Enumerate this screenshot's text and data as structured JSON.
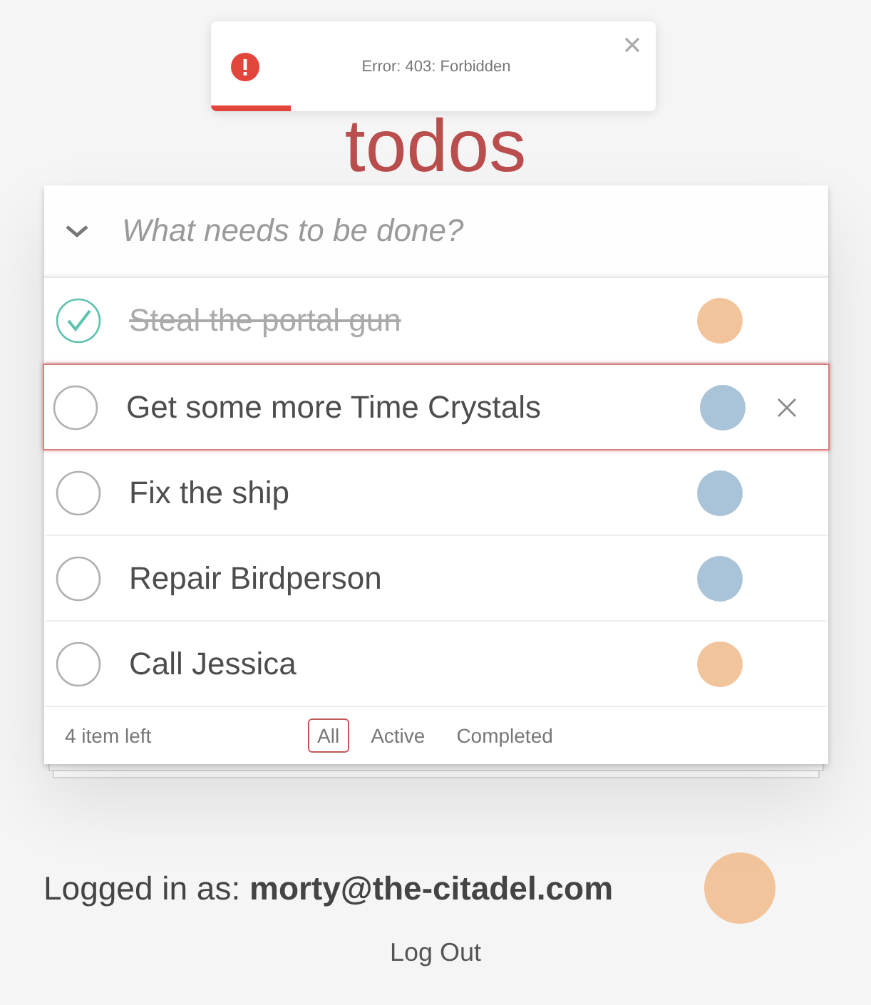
{
  "title": "todos",
  "toast": {
    "message": "Error: 403: Forbidden",
    "level": 0.18
  },
  "new_todo": {
    "placeholder": "What needs to be done?"
  },
  "todos": [
    {
      "text": "Steal the portal gun",
      "completed": true,
      "selected": false,
      "avatar": {
        "color": "#f2c49b"
      }
    },
    {
      "text": "Get some more Time Crystals",
      "completed": false,
      "selected": true,
      "avatar": {
        "color": "#a9c4d8"
      }
    },
    {
      "text": "Fix the ship",
      "completed": false,
      "selected": false,
      "avatar": {
        "color": "#a9c4d8"
      }
    },
    {
      "text": "Repair Birdperson",
      "completed": false,
      "selected": false,
      "avatar": {
        "color": "#a9c4d8"
      }
    },
    {
      "text": "Call Jessica",
      "completed": false,
      "selected": false,
      "avatar": {
        "color": "#f2c49b"
      }
    }
  ],
  "footer": {
    "count": "4 item left",
    "filters": [
      {
        "label": "All",
        "selected": true
      },
      {
        "label": "Active",
        "selected": false
      },
      {
        "label": "Completed",
        "selected": false
      }
    ]
  },
  "user": {
    "label": "Logged in as:",
    "email": "morty@the-citadel.com",
    "avatar": {
      "color": "#f2c49b"
    }
  },
  "logout": "Log Out"
}
